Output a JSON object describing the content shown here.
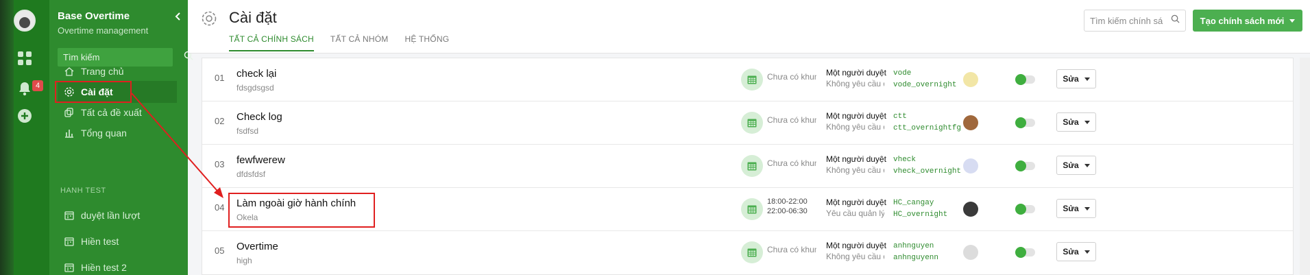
{
  "rail": {
    "notification_count": "4"
  },
  "sidebar": {
    "app_title": "Base Overtime",
    "app_subtitle": "Overtime management",
    "search_placeholder": "Tìm kiếm",
    "items": [
      {
        "label": "Trang chủ",
        "icon": "home-icon"
      },
      {
        "label": "Cài đặt",
        "icon": "gear-icon"
      },
      {
        "label": "Tất cả đề xuất",
        "icon": "copy-icon"
      },
      {
        "label": "Tổng quan",
        "icon": "bar-chart-icon"
      }
    ],
    "section_label": "HANH TEST",
    "groups": [
      {
        "label": "duyệt lần lượt",
        "icon": "calendar-icon"
      },
      {
        "label": "Hiền test",
        "icon": "calendar-icon"
      },
      {
        "label": "Hiền test 2",
        "icon": "calendar-icon"
      }
    ]
  },
  "header": {
    "title": "Cài đặt",
    "tabs": [
      {
        "label": "TẤT CẢ CHÍNH SÁCH",
        "active": true
      },
      {
        "label": "TẤT CẢ NHÓM",
        "active": false
      },
      {
        "label": "HỆ THỐNG",
        "active": false
      }
    ],
    "search_placeholder": "Tìm kiếm chính sá",
    "new_button": "Tạo chính sách mới"
  },
  "policies": [
    {
      "index": "01",
      "name": "check lại",
      "desc": "fdsgdsgsd",
      "time1": "Chưa có khung giờ",
      "time2": "",
      "approval": "Một người duyệt",
      "approval_sub": "Không yêu cầu quản lý",
      "code1": "vode",
      "code2": "vode_overnight",
      "avatar_color": "#f2e6a6",
      "edit": "Sửa"
    },
    {
      "index": "02",
      "name": "Check log",
      "desc": "fsdfsd",
      "time1": "Chưa có khung giờ",
      "time2": "",
      "approval": "Một người duyệt",
      "approval_sub": "Không yêu cầu quản lý",
      "code1": "ctt",
      "code2": "ctt_overnightfg",
      "avatar_color": "#a0683c",
      "edit": "Sửa"
    },
    {
      "index": "03",
      "name": "fewfwerew",
      "desc": "dfdsfdsf",
      "time1": "Chưa có khung giờ",
      "time2": "",
      "approval": "Một người duyệt",
      "approval_sub": "Không yêu cầu quản lý",
      "code1": "vheck",
      "code2": "vheck_overnight",
      "avatar_color": "#d7dcf2",
      "edit": "Sửa"
    },
    {
      "index": "04",
      "name": "Làm ngoài giờ hành chính",
      "desc": "Okela",
      "time1": "18:00-22:00",
      "time2": "22:00-06:30",
      "approval": "Một người duyệt",
      "approval_sub": "Yêu cầu quản lý duyệt",
      "code1": "HC_cangay",
      "code2": "HC_overnight",
      "avatar_color": "#3a3a3a",
      "edit": "Sửa"
    },
    {
      "index": "05",
      "name": "Overtime",
      "desc": "high",
      "time1": "Chưa có khung giờ",
      "time2": "",
      "approval": "Một người duyệt",
      "approval_sub": "Không yêu cầu quản lý",
      "code1": "anhnguyen",
      "code2": "anhnguyenn",
      "avatar_color": "#dcdcdc",
      "edit": "Sửa"
    }
  ],
  "colors": {
    "brand_green": "#2e8b2e",
    "accent_red": "#e01f1f",
    "button_green": "#4caf50"
  }
}
